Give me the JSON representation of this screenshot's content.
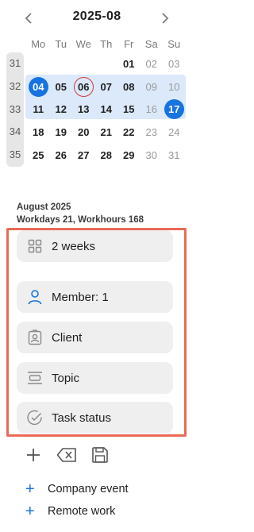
{
  "calendar": {
    "title": "2025-08",
    "weekdays": [
      "Mo",
      "Tu",
      "We",
      "Th",
      "Fr",
      "Sa",
      "Su"
    ],
    "weeks": [
      {
        "num": "31",
        "days": [
          "",
          "",
          "",
          "",
          "01",
          "02",
          "03"
        ]
      },
      {
        "num": "32",
        "days": [
          "04",
          "05",
          "06",
          "07",
          "08",
          "09",
          "10"
        ]
      },
      {
        "num": "33",
        "days": [
          "11",
          "12",
          "13",
          "14",
          "15",
          "16",
          "17"
        ]
      },
      {
        "num": "34",
        "days": [
          "18",
          "19",
          "20",
          "21",
          "22",
          "23",
          "24"
        ]
      },
      {
        "num": "35",
        "days": [
          "25",
          "26",
          "27",
          "28",
          "29",
          "30",
          "31"
        ]
      }
    ],
    "selected_start": "04",
    "selected_end": "17",
    "today": "06"
  },
  "summary": {
    "month": "August 2025",
    "stats": "Workdays 21, Workhours 168"
  },
  "filters": {
    "period": "2 weeks",
    "member": "Member: 1",
    "client": "Client",
    "topic": "Topic",
    "task_status": "Task status"
  },
  "links": {
    "company_event": "Company event",
    "remote_work": "Remote work"
  },
  "colors": {
    "accent": "#1673e0",
    "range": "#dbe9fb",
    "today_ring": "#d23b3b",
    "highlight_border": "#ea6a55"
  }
}
